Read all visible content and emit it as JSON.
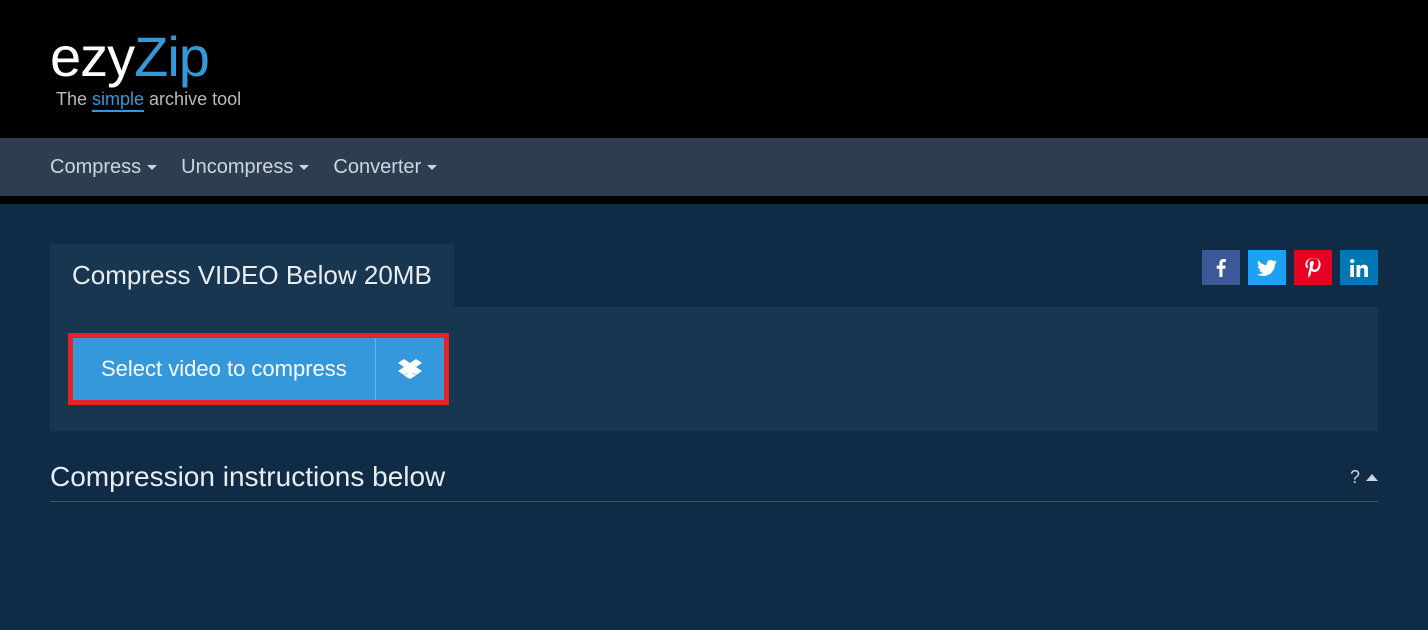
{
  "logo": {
    "part1": "ezy",
    "part2": "Zip"
  },
  "tagline": {
    "prefix": "The ",
    "highlight": "simple",
    "suffix": " archive tool"
  },
  "nav": {
    "compress": "Compress",
    "uncompress": "Uncompress",
    "converter": "Converter"
  },
  "main": {
    "tab_title": "Compress VIDEO Below 20MB",
    "select_button": "Select video to compress"
  },
  "instructions": {
    "title": "Compression instructions below",
    "help_label": "?"
  }
}
